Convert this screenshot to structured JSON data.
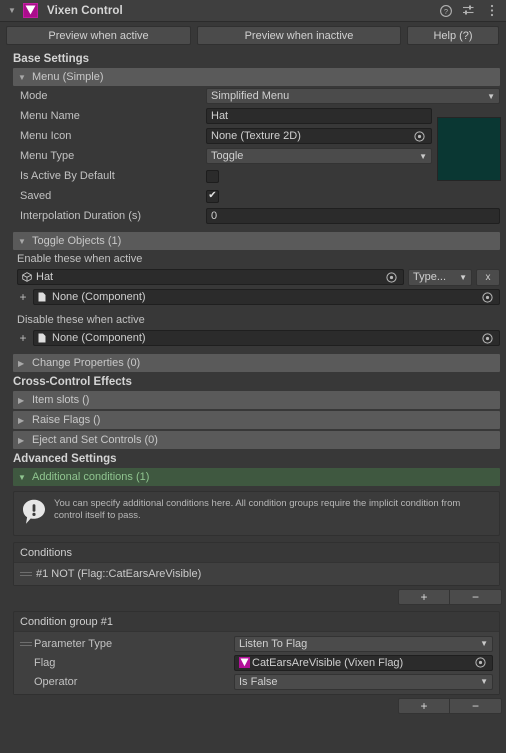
{
  "header": {
    "title": "Vixen Control",
    "logo_color": "#aa0d8c",
    "icons": [
      "help-icon",
      "preset-icon",
      "more-menu-icon"
    ]
  },
  "toolbar": {
    "preview_active": "Preview when active",
    "preview_inactive": "Preview when inactive",
    "help": "Help (?)"
  },
  "base_settings": {
    "section_label": "Base Settings",
    "menu_foldout": "Menu (Simple)",
    "rows": [
      {
        "label": "Mode",
        "value": "Simplified Menu",
        "type": "popup"
      },
      {
        "label": "Menu Name",
        "value": "Hat",
        "type": "text"
      },
      {
        "label": "Menu Icon",
        "value": "None (Texture 2D)",
        "type": "object"
      },
      {
        "label": "Menu Type",
        "value": "Toggle",
        "type": "popup"
      },
      {
        "label": "Is Active By Default",
        "value": "",
        "type": "checkbox",
        "checked": false
      },
      {
        "label": "Saved",
        "value": "✔",
        "type": "checkbox",
        "checked": true
      },
      {
        "label": "Interpolation Duration (s)",
        "value": "0",
        "type": "text"
      }
    ],
    "preview_swatch_color": "#0a3733"
  },
  "toggle_objects": {
    "foldout": "Toggle Objects (1)",
    "enable_label": "Enable these when active",
    "enable_object": "Hat",
    "enable_type_button": "Type...",
    "enable_remove_button": "x",
    "enable_component": "None (Component)",
    "disable_label": "Disable these when active",
    "disable_component": "None (Component)",
    "add_symbol": "+"
  },
  "change_properties": {
    "foldout": "Change Properties (0)"
  },
  "cross_control": {
    "section_label": "Cross-Control Effects",
    "items": [
      "Item slots ()",
      "Raise Flags ()",
      "Eject and Set Controls (0)"
    ]
  },
  "advanced": {
    "section_label": "Advanced Settings",
    "additional_conditions": "Additional conditions (1)",
    "help_text": "You can specify additional conditions here. All condition groups require the implicit condition from control itself to pass."
  },
  "conditions": {
    "panel_title": "Conditions",
    "items": [
      "#1 NOT (Flag::CatEarsAreVisible)"
    ],
    "plus": "+",
    "minus": "−"
  },
  "condition_group": {
    "panel_title": "Condition group #1",
    "rows": [
      {
        "label": "Parameter Type",
        "value": "Listen To Flag",
        "type": "popup"
      },
      {
        "label": "Flag",
        "value": "CatEarsAreVisible (Vixen Flag)",
        "type": "object"
      },
      {
        "label": "Operator",
        "value": "Is False",
        "type": "popup"
      }
    ],
    "plus": "+",
    "minus": "−"
  }
}
